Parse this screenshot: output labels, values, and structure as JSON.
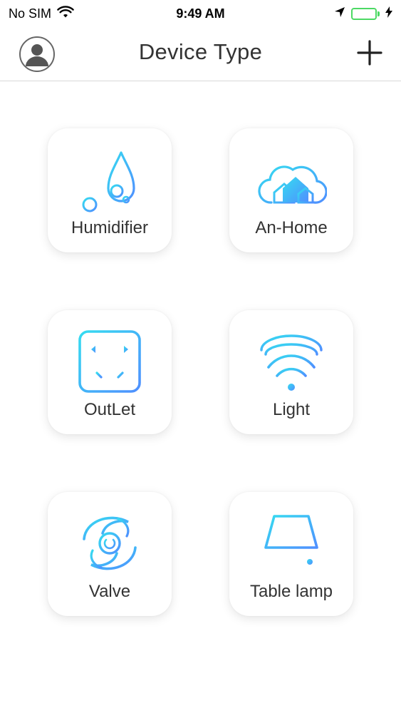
{
  "status_bar": {
    "carrier": "No SIM",
    "time": "9:49 AM",
    "battery_level": 0.9,
    "icons": [
      "wifi-icon",
      "location-arrow-icon",
      "battery-icon",
      "charging-bolt-icon"
    ]
  },
  "nav": {
    "title": "Device Type",
    "left_icon": "user-avatar-icon",
    "right_icon": "plus-icon"
  },
  "colors": {
    "accent_gradient_start": "#35dcf0",
    "accent_gradient_end": "#4f8fff",
    "battery": "#4cd964",
    "text": "#333333"
  },
  "devices": [
    {
      "label": "Humidifier",
      "icon": "water-drop-icon"
    },
    {
      "label": "An-Home",
      "icon": "cloud-home-icon"
    },
    {
      "label": "OutLet",
      "icon": "outlet-icon"
    },
    {
      "label": "Light",
      "icon": "ceiling-light-icon"
    },
    {
      "label": "Valve",
      "icon": "valve-icon"
    },
    {
      "label": "Table lamp",
      "icon": "table-lamp-icon"
    }
  ]
}
